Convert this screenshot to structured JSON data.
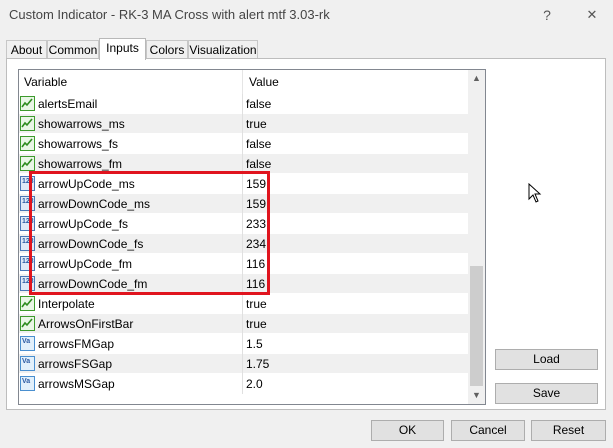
{
  "window": {
    "title": "Custom Indicator - RK-3 MA Cross with alert mtf 3.03-rk",
    "help_glyph": "?",
    "close_glyph": "✕"
  },
  "tabs": [
    {
      "label": "About",
      "active": false
    },
    {
      "label": "Common",
      "active": false
    },
    {
      "label": "Inputs",
      "active": true
    },
    {
      "label": "Colors",
      "active": false
    },
    {
      "label": "Visualization",
      "active": false
    }
  ],
  "grid": {
    "columns": {
      "variable": "Variable",
      "value": "Value"
    },
    "rows": [
      {
        "name": "alertsEmail",
        "value": "false",
        "type": "bool"
      },
      {
        "name": "showarrows_ms",
        "value": "true",
        "type": "bool"
      },
      {
        "name": "showarrows_fs",
        "value": "false",
        "type": "bool"
      },
      {
        "name": "showarrows_fm",
        "value": "false",
        "type": "bool"
      },
      {
        "name": "arrowUpCode_ms",
        "value": "159",
        "type": "int"
      },
      {
        "name": "arrowDownCode_ms",
        "value": "159",
        "type": "int"
      },
      {
        "name": "arrowUpCode_fs",
        "value": "233",
        "type": "int"
      },
      {
        "name": "arrowDownCode_fs",
        "value": "234",
        "type": "int"
      },
      {
        "name": "arrowUpCode_fm",
        "value": "116",
        "type": "int"
      },
      {
        "name": "arrowDownCode_fm",
        "value": "116",
        "type": "int"
      },
      {
        "name": "Interpolate",
        "value": "true",
        "type": "bool"
      },
      {
        "name": "ArrowsOnFirstBar",
        "value": "true",
        "type": "bool"
      },
      {
        "name": "arrowsFMGap",
        "value": "1.5",
        "type": "double"
      },
      {
        "name": "arrowsFSGap",
        "value": "1.75",
        "type": "double"
      },
      {
        "name": "arrowsMSGap",
        "value": "2.0",
        "type": "double"
      }
    ],
    "icon_labels": {
      "int": "123",
      "double": "Va"
    }
  },
  "side_buttons": {
    "load": "Load",
    "save": "Save"
  },
  "footer_buttons": {
    "ok": "OK",
    "cancel": "Cancel",
    "reset": "Reset"
  },
  "colors": {
    "highlight": "#e0141e",
    "row_alt": "#f0f0f0",
    "bool_icon": "#3c9a2c",
    "int_icon": "#4a76b6"
  }
}
